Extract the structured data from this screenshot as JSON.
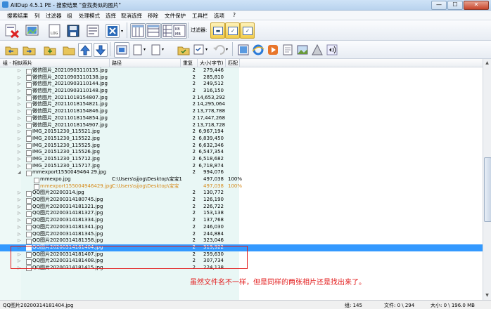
{
  "window": {
    "title": "AllDup 4.5.1 PE - 搜索结果 \"查找类似的图片\"",
    "minimize": "—",
    "maximize": "☐",
    "close": "✕"
  },
  "menu": [
    "搜索结果",
    "列",
    "过滤器",
    "组",
    "处理模式",
    "选择",
    "取消选择",
    "移除",
    "文件保护",
    "工具栏",
    "选项",
    "?"
  ],
  "toolbar": {
    "filter_label": "过滤器:"
  },
  "columns": {
    "group": "组 - 相似照片",
    "path": "路径",
    "dup": "重复",
    "size": "大小(字节)",
    "match": "匹配"
  },
  "rows": [
    {
      "name": "微信图片_20210903110135.jpg",
      "dup": "2",
      "size": "279,446"
    },
    {
      "name": "微信图片_20210903110138.jpg",
      "dup": "2",
      "size": "285,810"
    },
    {
      "name": "微信图片_20210903110144.jpg",
      "dup": "2",
      "size": "249,512"
    },
    {
      "name": "微信图片_20210903110148.jpg",
      "dup": "2",
      "size": "316,150"
    },
    {
      "name": "微信图片_20211018154807.jpg",
      "dup": "2",
      "size": "14,653,292"
    },
    {
      "name": "微信图片_20211018154821.jpg",
      "dup": "2",
      "size": "14,295,064"
    },
    {
      "name": "微信图片_20211018154846.jpg",
      "dup": "2",
      "size": "13,778,788"
    },
    {
      "name": "微信图片_20211018154854.jpg",
      "dup": "2",
      "size": "17,447,268"
    },
    {
      "name": "微信图片_20211018154907.jpg",
      "dup": "2",
      "size": "13,718,728"
    },
    {
      "name": "IMG_20151230_115521.jpg",
      "dup": "2",
      "size": "6,967,194"
    },
    {
      "name": "IMG_20151230_115522.jpg",
      "dup": "2",
      "size": "6,839,450"
    },
    {
      "name": "IMG_20151230_115525.jpg",
      "dup": "2",
      "size": "6,632,346"
    },
    {
      "name": "IMG_20151230_115526.jpg",
      "dup": "2",
      "size": "6,547,354"
    },
    {
      "name": "IMG_20151230_115712.jpg",
      "dup": "2",
      "size": "6,518,682"
    },
    {
      "name": "IMG_20151230_115717.jpg",
      "dup": "2",
      "size": "6,718,874"
    },
    {
      "name": "mmexport1550049464 29.jpg",
      "dup": "2",
      "size": "994,076",
      "expanded": true
    },
    {
      "name": "mmexpo.jpg",
      "path": "C:\\Users\\sjjog\\Desktop\\宝宝1",
      "dup": "",
      "size": "497,038",
      "match": "100%",
      "child": true
    },
    {
      "name": "mmexport155004946429.jpg",
      "path": "C:\\Users\\sjjog\\Desktop\\宝宝",
      "dup": "",
      "size": "497,038",
      "match": "100%",
      "child": true,
      "orange": true
    },
    {
      "name": "QQ图片20200314.jpg",
      "dup": "2",
      "size": "130,772"
    },
    {
      "name": "QQ图片20200314180745.jpg",
      "dup": "2",
      "size": "126,190"
    },
    {
      "name": "QQ图片20200314181321.jpg",
      "dup": "2",
      "size": "226,722"
    },
    {
      "name": "QQ图片20200314181327.jpg",
      "dup": "2",
      "size": "153,138"
    },
    {
      "name": "QQ图片20200314181334.jpg",
      "dup": "2",
      "size": "137,768"
    },
    {
      "name": "QQ图片20200314181341.jpg",
      "dup": "2",
      "size": "246,030"
    },
    {
      "name": "QQ图片20200314181345.jpg",
      "dup": "2",
      "size": "244,884"
    },
    {
      "name": "QQ图片20200314181358.jpg",
      "dup": "2",
      "size": "323,046"
    },
    {
      "name": "QQ图片20200314181404.jpg",
      "dup": "2",
      "size": "319,922",
      "selected": true
    },
    {
      "name": "QQ图片20200314181407.jpg",
      "dup": "2",
      "size": "259,630"
    },
    {
      "name": "QQ图片20200314181408.jpg",
      "dup": "2",
      "size": "307,734"
    },
    {
      "name": "QQ图片20200314181415.jpg",
      "dup": "2",
      "size": "224,138"
    }
  ],
  "annotation": "虽然文件名不一样，但是同样的两张相片还是找出来了。",
  "status": {
    "current": "QQ图片20200314181404.jpg",
    "groups": "组: 145",
    "files": "文件: 0 \\ 294",
    "size": "大小: 0 \\ 196.0 MB"
  },
  "colors": {
    "selected": "#3399ff",
    "highlight": "#e21b1b",
    "orange_text": "#d68a1a"
  }
}
